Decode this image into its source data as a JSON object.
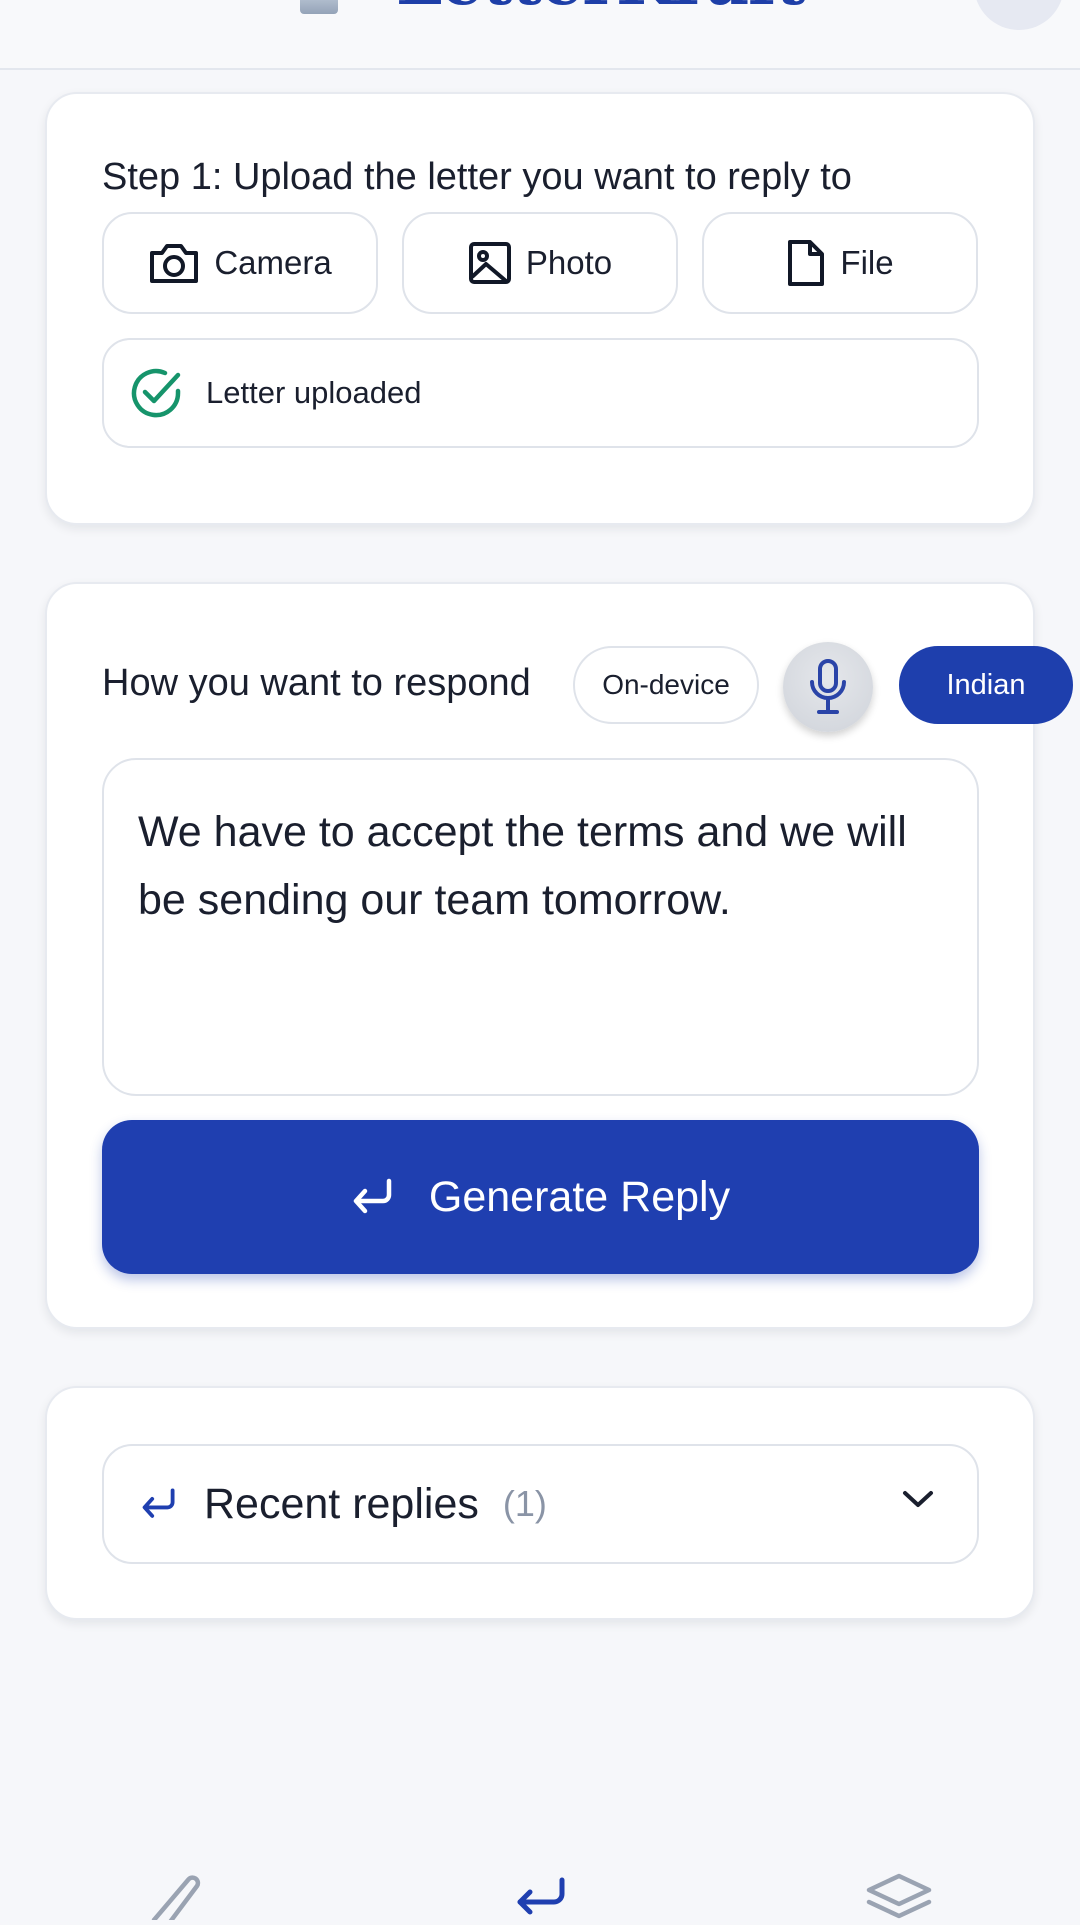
{
  "header": {
    "app_title": "LetterKraft"
  },
  "upload": {
    "step_title": "Step 1: Upload the letter you want to reply to",
    "buttons": {
      "camera": "Camera",
      "photo": "Photo",
      "file": "File"
    },
    "status": "Letter uploaded",
    "status_color": "#16946b"
  },
  "respond": {
    "label": "How you want to respond",
    "mode_chip": "On-device",
    "language_chip": "Indian",
    "input_value": "We have to accept the terms and we will be sending our team tomorrow.",
    "generate_label": "Generate Reply",
    "accent_color": "#1f3fb0"
  },
  "recent": {
    "title": "Recent replies",
    "count": "(1)"
  },
  "icons": {
    "camera": "camera-icon",
    "photo": "image-icon",
    "file": "file-icon",
    "status": "check-circle-icon",
    "mic": "microphone-icon",
    "generate": "enter-arrow-icon",
    "recent": "enter-arrow-icon",
    "chevron": "chevron-down-icon",
    "nav": [
      "pencil-icon",
      "enter-arrow-icon",
      "layers-icon"
    ]
  }
}
